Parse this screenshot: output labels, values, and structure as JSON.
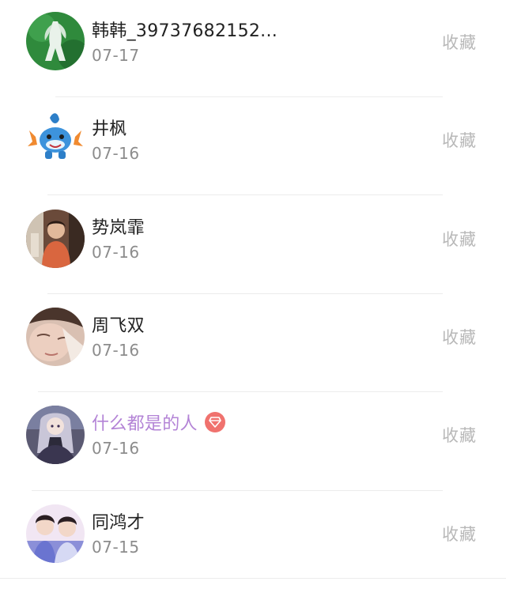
{
  "notifications": [
    {
      "name": "韩韩_39737682152...",
      "date": "07-17",
      "action": "收藏",
      "vip": false,
      "avatar": "avatar-green-statue"
    },
    {
      "name": "井枫",
      "date": "07-16",
      "action": "收藏",
      "vip": false,
      "avatar": "avatar-mudkip"
    },
    {
      "name": "势岚霏",
      "date": "07-16",
      "action": "收藏",
      "vip": false,
      "avatar": "avatar-person-orange"
    },
    {
      "name": "周飞双",
      "date": "07-16",
      "action": "收藏",
      "vip": false,
      "avatar": "avatar-face-closeup"
    },
    {
      "name": "什么都是的人",
      "date": "07-16",
      "action": "收藏",
      "vip": true,
      "badge_icon": "diamond-icon",
      "avatar": "avatar-anime-girl"
    },
    {
      "name": "同鸿才",
      "date": "07-15",
      "action": "收藏",
      "vip": false,
      "avatar": "avatar-two-people"
    }
  ],
  "colors": {
    "name": "#222222",
    "vip_name": "#b383d6",
    "date": "#8c8c8c",
    "action": "#b8b8b8",
    "badge": "#f0726e",
    "divider": "#ececec"
  }
}
